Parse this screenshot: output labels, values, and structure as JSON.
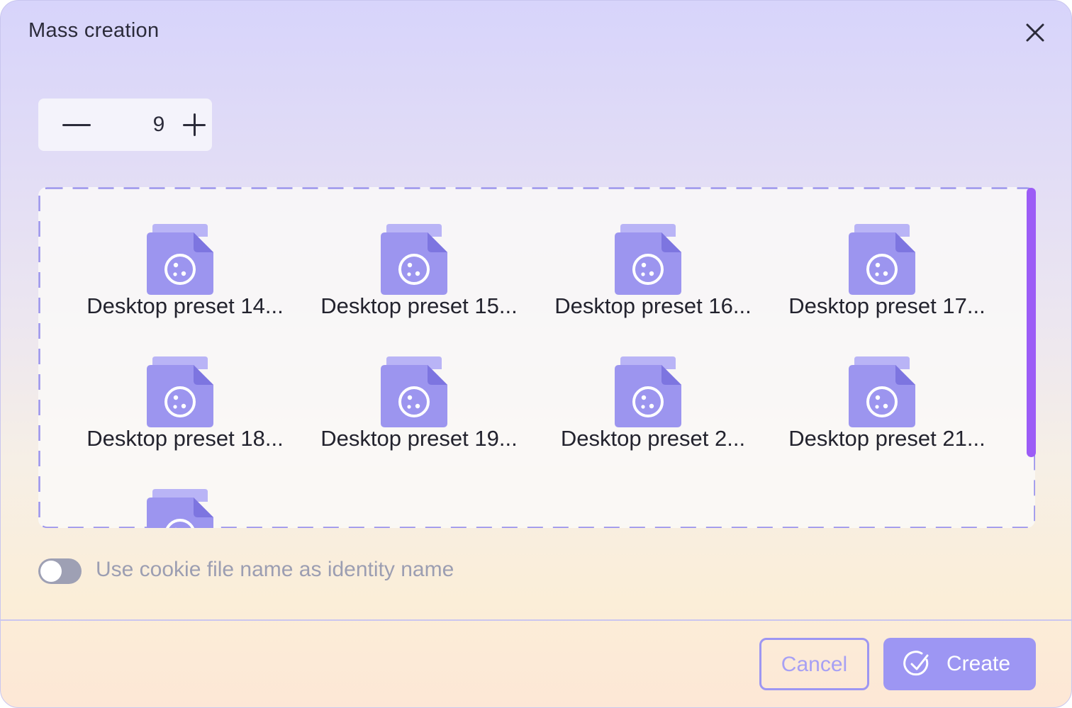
{
  "dialog": {
    "title": "Mass creation",
    "close_icon": "close-icon"
  },
  "stepper": {
    "value": "9",
    "decrement_icon": "minus-icon",
    "increment_icon": "plus-icon"
  },
  "files": [
    {
      "name": "Desktop preset 14...",
      "icon": "cookie-file-icon"
    },
    {
      "name": "Desktop preset 15...",
      "icon": "cookie-file-icon"
    },
    {
      "name": "Desktop preset 16...",
      "icon": "cookie-file-icon"
    },
    {
      "name": "Desktop preset 17...",
      "icon": "cookie-file-icon"
    },
    {
      "name": "Desktop preset 18...",
      "icon": "cookie-file-icon"
    },
    {
      "name": "Desktop preset 19...",
      "icon": "cookie-file-icon"
    },
    {
      "name": "Desktop preset 2...",
      "icon": "cookie-file-icon"
    },
    {
      "name": "Desktop preset 21...",
      "icon": "cookie-file-icon"
    },
    {
      "name": "",
      "icon": "cookie-file-icon"
    }
  ],
  "options": {
    "use_filename_label": "Use cookie file name as identity name",
    "use_filename_enabled": false
  },
  "footer": {
    "cancel_label": "Cancel",
    "create_label": "Create",
    "create_icon": "check-circle-icon"
  },
  "colors": {
    "accent": "#9d96f3",
    "scrollbar": "#9c5cf6",
    "file_icon": "#9c95ef",
    "text": "#23232e",
    "muted_text": "#9c9eb2"
  }
}
